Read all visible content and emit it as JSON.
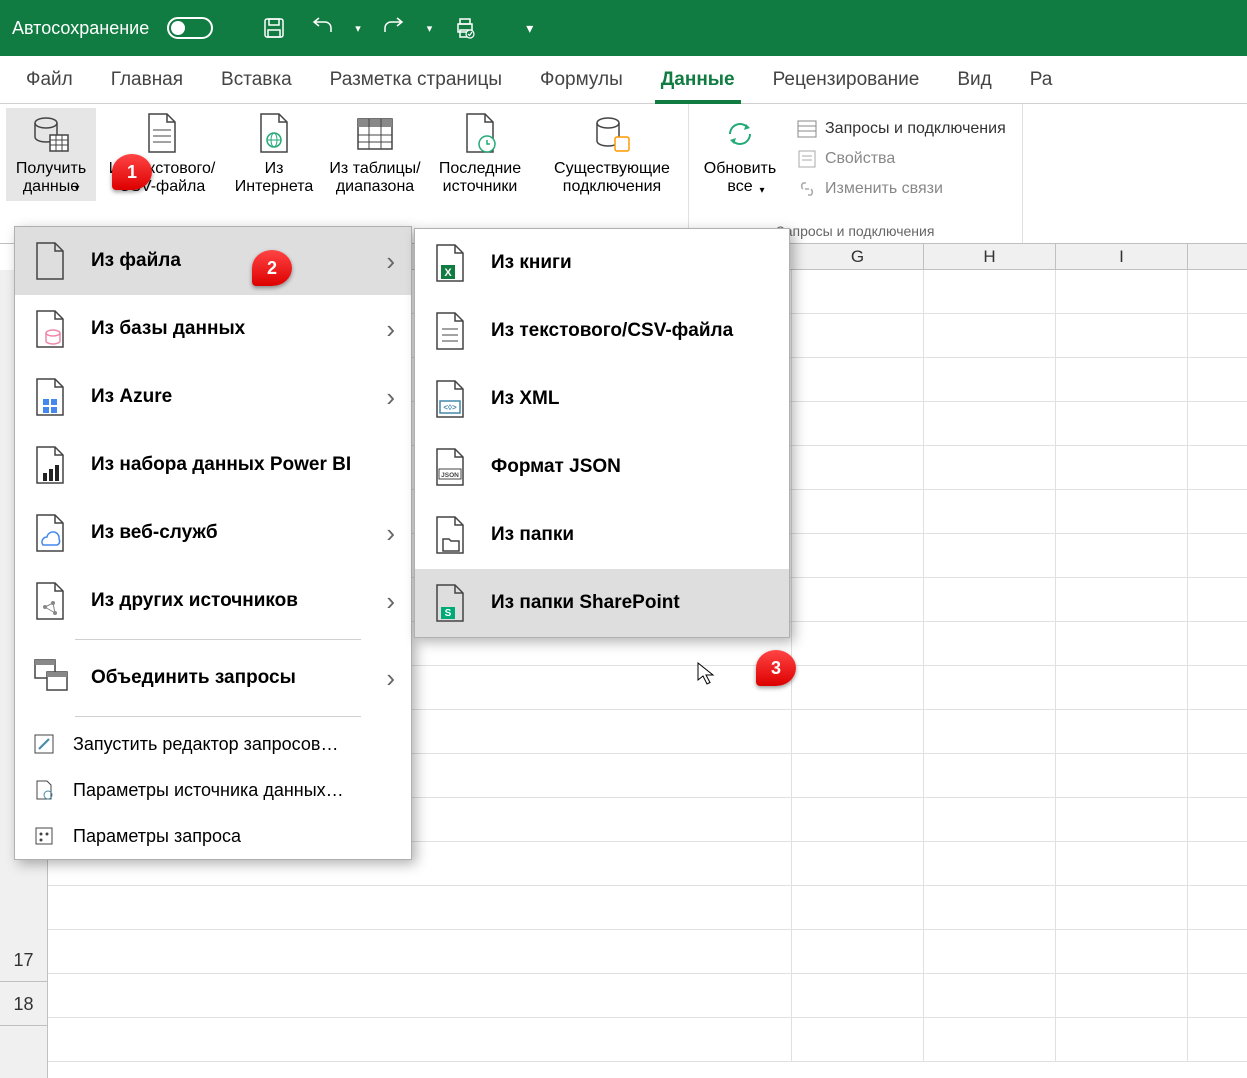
{
  "titlebar": {
    "autosave": "Автосохранение"
  },
  "tabs": [
    "Файл",
    "Главная",
    "Вставка",
    "Разметка страницы",
    "Формулы",
    "Данные",
    "Рецензирование",
    "Вид",
    "Ра"
  ],
  "active_tab": 5,
  "ribbon": {
    "get_data": "Получить\nданные",
    "from_csv": "Из текстового/\nCSV-файла",
    "from_web": "Из\nИнтернета",
    "from_table": "Из таблицы/\nдиапазона",
    "recent": "Последние\nисточники",
    "existing": "Существующие\nподключения",
    "refresh": "Обновить\nвсе",
    "queries": "Запросы и подключения",
    "props": "Свойства",
    "edit_links": "Изменить связи",
    "group_name": "Запросы и подключения"
  },
  "menu1": {
    "from_file": "Из файла",
    "from_db": "Из базы данных",
    "from_azure": "Из Azure",
    "from_powerbi": "Из набора данных Power BI",
    "from_web": "Из веб-служб",
    "from_other": "Из других источников",
    "combine": "Объединить запросы",
    "launch_editor": "Запустить редактор запросов…",
    "source_params": "Параметры источника данных…",
    "query_params": "Параметры запроса"
  },
  "menu2": {
    "from_workbook": "Из книги",
    "from_csv": "Из текстового/CSV-файла",
    "from_xml": "Из XML",
    "from_json": "Формат JSON",
    "from_folder": "Из папки",
    "from_sharepoint": "Из папки SharePoint"
  },
  "columns": [
    "G",
    "H",
    "I"
  ],
  "rows": [
    "17",
    "18"
  ],
  "badges": [
    "1",
    "2",
    "3"
  ]
}
